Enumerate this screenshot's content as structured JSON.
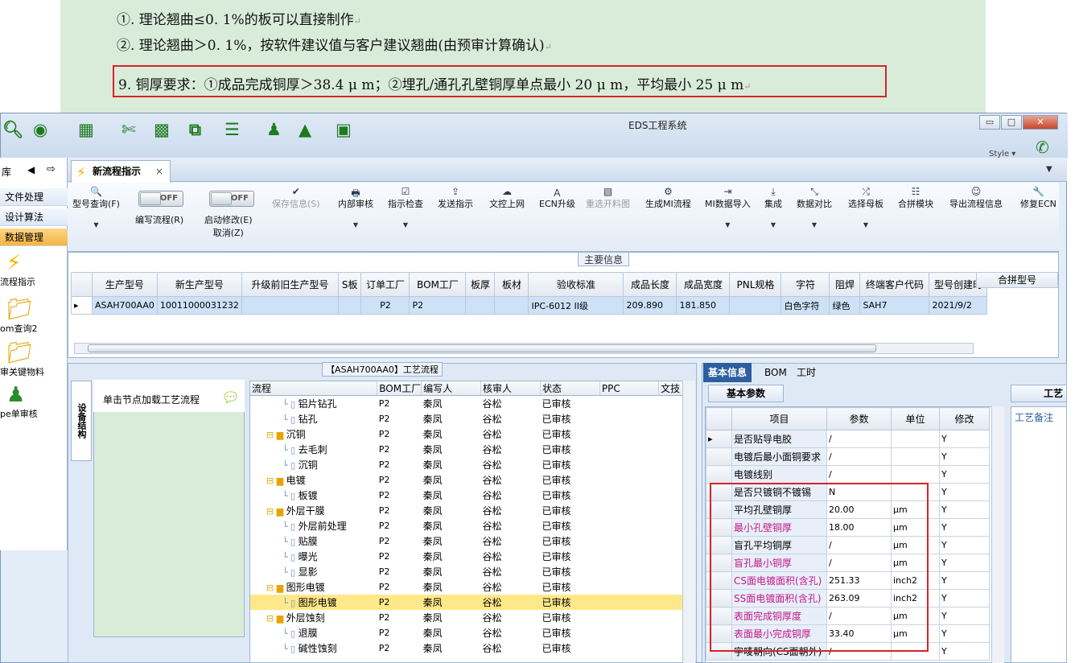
{
  "document": {
    "line1": "①. 理论翘曲≤0. 1%的板可以直接制作",
    "line2": "②. 理论翘曲＞0. 1%，按软件建议值与客户建议翘曲(由预审计算确认)",
    "line3": "9.   铜厚要求：①成品完成铜厚＞38.4 μ m；②埋孔/通孔孔壁铜厚单点最小 20 μ m，平均最小 25 μ m",
    "paragraph_mark": "↵"
  },
  "window": {
    "title": "EDS工程系统",
    "style_label": "Style ▾",
    "min_label": "▭",
    "max_label": "□",
    "close_label": "✕"
  },
  "toolbar_icons": [
    "search-icon",
    "globe-icon",
    "grid-icon",
    "scissors-icon",
    "film-icon",
    "copy-icon",
    "list-icon",
    "user-icon",
    "chart-icon",
    "monitor-icon"
  ],
  "left_nav": {
    "items": [
      {
        "label": "文件处理"
      },
      {
        "label": "设计算法"
      },
      {
        "label": "数据管理"
      }
    ],
    "big_items": [
      {
        "label": "流程指示"
      },
      {
        "label": "om查询2"
      },
      {
        "label": "审关键物料"
      },
      {
        "label": "pe单审核"
      }
    ]
  },
  "tabs": {
    "active": "新流程指示",
    "close": "×"
  },
  "ribbon": {
    "items": [
      {
        "label": "型号查询(F)",
        "icon": "🔍"
      },
      {
        "label": "编写流程(R)",
        "toggle": "OFF"
      },
      {
        "label": "启动修改(E)",
        "label2": "取消(Z)",
        "toggle": "OFF"
      },
      {
        "label": "保存信息(S)",
        "icon": "✔"
      },
      {
        "label": "内部审核",
        "icon": "🖶"
      },
      {
        "label": "指示检查",
        "icon": "☑"
      },
      {
        "label": "发送指示",
        "icon": "⇪"
      },
      {
        "label": "文控上网",
        "icon": "☁"
      },
      {
        "label": "ECN升级",
        "icon": "Ａ"
      },
      {
        "label": "重选开料图",
        "icon": "▧"
      },
      {
        "label": "生成MI流程",
        "icon": "⚙"
      },
      {
        "label": "MI数据导入",
        "icon": "⇥"
      },
      {
        "label": "集成",
        "icon": "⤓"
      },
      {
        "label": "数据对比",
        "icon": "⤡"
      },
      {
        "label": "选择母板",
        "icon": "⤮"
      },
      {
        "label": "合拼模块",
        "icon": "☷"
      },
      {
        "label": "导出流程信息",
        "icon": "☺"
      },
      {
        "label": "修复ECN",
        "icon": "🔧"
      }
    ]
  },
  "main_info": {
    "title": "主要信息",
    "columns": [
      "生产型号",
      "新生产型号",
      "升级前旧生产型号",
      "S板",
      "订单工厂",
      "BOM工厂",
      "板厚",
      "板材",
      "验收标准",
      "成品长度",
      "成品宽度",
      "PNL规格",
      "字符",
      "阻焊",
      "终端客户代码",
      "型号创建时"
    ],
    "row": [
      "ASAH700AA0",
      "10011000031232",
      "",
      "",
      "P2",
      "P2",
      "",
      "",
      "IPC-6012 II级",
      "209.890",
      "181.850",
      "",
      "白色字符",
      "绿色",
      "SAH7",
      "2021/9/2"
    ],
    "extra_column": "合拼型号"
  },
  "flow": {
    "title": "【ASAH700AA0】工艺流程",
    "side_tab": "设备结构",
    "node_hint": "单击节点加载工艺流程",
    "columns": [
      "流程",
      "BOM工厂",
      "编写人",
      "核审人",
      "状态",
      "PPC",
      "文技"
    ],
    "rows": [
      {
        "name": "铝片钻孔",
        "type": "file",
        "factory": "P2",
        "writer": "秦凤",
        "reviewer": "谷松",
        "status": "已审核"
      },
      {
        "name": "钻孔",
        "type": "file",
        "factory": "P2",
        "writer": "秦凤",
        "reviewer": "谷松",
        "status": "已审核"
      },
      {
        "name": "沉铜",
        "type": "folder",
        "factory": "P2",
        "writer": "秦凤",
        "reviewer": "谷松",
        "status": "已审核"
      },
      {
        "name": "去毛刺",
        "type": "file",
        "factory": "P2",
        "writer": "秦凤",
        "reviewer": "谷松",
        "status": "已审核"
      },
      {
        "name": "沉铜",
        "type": "file",
        "factory": "P2",
        "writer": "秦凤",
        "reviewer": "谷松",
        "status": "已审核"
      },
      {
        "name": "电镀",
        "type": "folder",
        "factory": "P2",
        "writer": "秦凤",
        "reviewer": "谷松",
        "status": "已审核"
      },
      {
        "name": "板镀",
        "type": "file",
        "factory": "P2",
        "writer": "秦凤",
        "reviewer": "谷松",
        "status": "已审核"
      },
      {
        "name": "外层干膜",
        "type": "folder",
        "factory": "P2",
        "writer": "秦凤",
        "reviewer": "谷松",
        "status": "已审核"
      },
      {
        "name": "外层前处理",
        "type": "file",
        "factory": "P2",
        "writer": "秦凤",
        "reviewer": "谷松",
        "status": "已审核"
      },
      {
        "name": "贴膜",
        "type": "file",
        "factory": "P2",
        "writer": "秦凤",
        "reviewer": "谷松",
        "status": "已审核"
      },
      {
        "name": "曝光",
        "type": "file",
        "factory": "P2",
        "writer": "秦凤",
        "reviewer": "谷松",
        "status": "已审核"
      },
      {
        "name": "显影",
        "type": "file",
        "factory": "P2",
        "writer": "秦凤",
        "reviewer": "谷松",
        "status": "已审核"
      },
      {
        "name": "图形电镀",
        "type": "folder",
        "factory": "P2",
        "writer": "秦凤",
        "reviewer": "谷松",
        "status": "已审核"
      },
      {
        "name": "图形电镀",
        "type": "file",
        "factory": "P2",
        "writer": "秦凤",
        "reviewer": "谷松",
        "status": "已审核",
        "selected": true
      },
      {
        "name": "外层蚀刻",
        "type": "folder",
        "factory": "P2",
        "writer": "秦凤",
        "reviewer": "谷松",
        "status": "已审核"
      },
      {
        "name": "退膜",
        "type": "file",
        "factory": "P2",
        "writer": "秦凤",
        "reviewer": "谷松",
        "status": "已审核"
      },
      {
        "name": "碱性蚀刻",
        "type": "file",
        "factory": "P2",
        "writer": "秦凤",
        "reviewer": "谷松",
        "status": "已审核"
      }
    ]
  },
  "info": {
    "tabs": [
      "基本信息",
      "BOM",
      "工时"
    ],
    "sub_tab": "基本参数",
    "columns": [
      "项目",
      "参数",
      "单位",
      "修改"
    ],
    "rows": [
      {
        "name": "是否贴导电胶",
        "value": "/",
        "unit": "",
        "mod": "Y"
      },
      {
        "name": "电镀后最小面铜要求",
        "value": "/",
        "unit": "",
        "mod": "Y"
      },
      {
        "name": "电镀线别",
        "value": "/",
        "unit": "",
        "mod": "Y"
      },
      {
        "name": "是否只镀铜不镀锡",
        "value": "N",
        "unit": "",
        "mod": "Y"
      },
      {
        "name": "平均孔壁铜厚",
        "value": "20.00",
        "unit": "μm",
        "mod": "Y"
      },
      {
        "name": "最小孔壁铜厚",
        "value": "18.00",
        "unit": "μm",
        "mod": "Y",
        "pink": true
      },
      {
        "name": "盲孔平均铜厚",
        "value": "/",
        "unit": "μm",
        "mod": "Y"
      },
      {
        "name": "盲孔最小铜厚",
        "value": "/",
        "unit": "μm",
        "mod": "Y",
        "pink": true
      },
      {
        "name": "CS面电镀面积(含孔)",
        "value": "251.33",
        "unit": "inch2",
        "mod": "Y",
        "pink": true
      },
      {
        "name": "SS面电镀面积(含孔)",
        "value": "263.09",
        "unit": "inch2",
        "mod": "Y",
        "pink": true
      },
      {
        "name": "表面完成铜厚度",
        "value": "/",
        "unit": "μm",
        "mod": "Y",
        "pink": true
      },
      {
        "name": "表面最小完成铜厚",
        "value": "33.40",
        "unit": "μm",
        "mod": "Y",
        "pink": true
      },
      {
        "name": "字唛朝向(CS面朝外)",
        "value": "/",
        "unit": "",
        "mod": "Y"
      }
    ],
    "craft_tab": "工艺",
    "craft_note": "工艺备注"
  }
}
